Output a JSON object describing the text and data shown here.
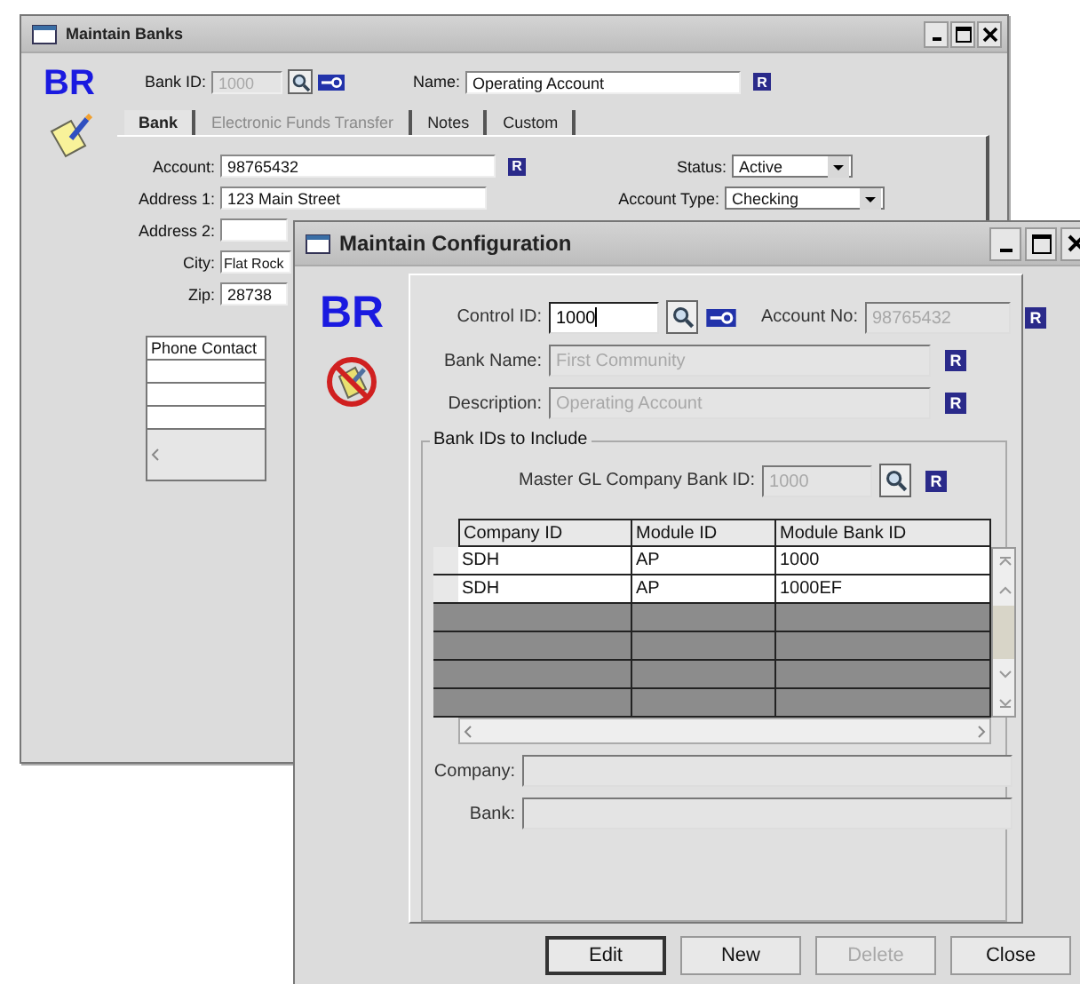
{
  "back_window": {
    "title": "Maintain Banks",
    "logo": "BR",
    "bank_id": {
      "label": "Bank ID:",
      "value": "1000",
      "disabled": true
    },
    "name": {
      "label": "Name:",
      "value": "Operating Account",
      "badge": "R"
    },
    "tabs": [
      {
        "label": "Bank",
        "selected": true,
        "disabled": false
      },
      {
        "label": "Electronic Funds Transfer",
        "selected": false,
        "disabled": true
      },
      {
        "label": "Notes",
        "selected": false,
        "disabled": false
      },
      {
        "label": "Custom",
        "selected": false,
        "disabled": false
      }
    ],
    "account": {
      "label": "Account:",
      "value": "98765432",
      "badge": "R"
    },
    "status": {
      "label": "Status:",
      "value": "Active"
    },
    "address_1": {
      "label": "Address 1:",
      "value": "123 Main Street"
    },
    "account_type": {
      "label": "Account Type:",
      "value": "Checking"
    },
    "address_2": {
      "label": "Address 2:"
    },
    "city": {
      "label": "City:",
      "value": "Flat Rock"
    },
    "zip": {
      "label": "Zip:",
      "value": "28738"
    },
    "phone_grid": {
      "columns": [
        "Phone Contact"
      ]
    }
  },
  "front_window": {
    "title": "Maintain Configuration",
    "logo": "BR",
    "control_id": {
      "label": "Control ID:",
      "value": "1000",
      "focused": true
    },
    "account_no": {
      "label": "Account No:",
      "value": "98765432",
      "disabled": true,
      "badge": "R"
    },
    "bank_name": {
      "label": "Bank Name:",
      "value": "First Community",
      "disabled": true,
      "badge": "R"
    },
    "description": {
      "label": "Description:",
      "value": "Operating Account",
      "disabled": true,
      "badge": "R"
    },
    "group": {
      "title": "Bank IDs to Include",
      "master": {
        "label": "Master GL Company Bank ID:",
        "value": "1000",
        "disabled": true,
        "badge": "R"
      },
      "table": {
        "columns": [
          "Company ID",
          "Module ID",
          "Module Bank ID"
        ],
        "rows": [
          [
            "SDH",
            "AP",
            "1000"
          ],
          [
            "SDH",
            "AP",
            "1000EF"
          ]
        ]
      },
      "company": {
        "label": "Company:"
      },
      "bank": {
        "label": "Bank:"
      }
    },
    "buttons": [
      {
        "label": "Edit",
        "default": true,
        "disabled": false
      },
      {
        "label": "New",
        "default": false,
        "disabled": false
      },
      {
        "label": "Delete",
        "default": false,
        "disabled": true
      },
      {
        "label": "Close",
        "default": false,
        "disabled": false
      }
    ]
  }
}
